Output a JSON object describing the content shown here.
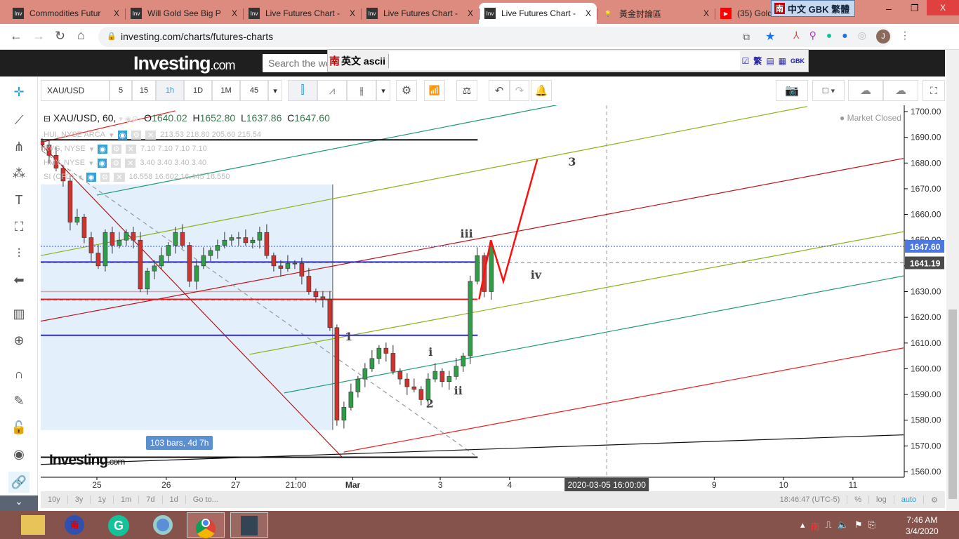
{
  "browser": {
    "tabs": [
      {
        "label": "Commodities Futur",
        "icon": "investing-favicon"
      },
      {
        "label": "Will Gold See Big P",
        "icon": "investing-favicon"
      },
      {
        "label": "Live Futures Chart -",
        "icon": "investing-favicon"
      },
      {
        "label": "Live Futures Chart -",
        "icon": "investing-favicon"
      },
      {
        "label": "Live Futures Chart -",
        "icon": "investing-favicon",
        "active": true
      },
      {
        "label": "黃金討論區",
        "icon": "bulb-favicon"
      },
      {
        "label": "(35) Gold",
        "icon": "youtube-favicon"
      }
    ],
    "tab_close": "X",
    "ime_badge": "中文 GBK 繁體",
    "url": "investing.com/charts/futures-charts",
    "profile_initial": "J"
  },
  "site": {
    "logo": "Investing",
    "logo_suffix": ".com",
    "search_placeholder": "Search the we"
  },
  "ime_bar": {
    "mode": "英文 ascii",
    "icon": "南",
    "buttons": [
      "繁",
      "GBK"
    ]
  },
  "toolbar": {
    "symbol": "XAU/USD",
    "intervals": [
      "5",
      "15",
      "1h",
      "1D",
      "1M",
      "45"
    ],
    "active_interval": "1h"
  },
  "legend": {
    "main": {
      "title": "XAU/USD, 60,",
      "o": "O",
      "o_val": "1640.02",
      "h": "H",
      "h_val": "1652.80",
      "l": "L",
      "l_val": "1637.86",
      "c": "C",
      "c_val": "1647.60"
    },
    "studies": [
      {
        "name": "HUI, NYSE ARCA",
        "vals": "213.53   218.80   205.60   215.54"
      },
      {
        "name": "RVG, NYSE",
        "vals": "7.10   7.10   7.10   7.10"
      },
      {
        "name": "HMY, NYSE",
        "vals": "3.40   3.40   3.40   3.40"
      },
      {
        "name": "SI (CFD)",
        "vals": "16.558   16.602   16.445   16.550"
      }
    ]
  },
  "status": "Market Closed",
  "range_label": "103 bars, 4d 7h",
  "watermark": "Investing.com",
  "wave_labels": [
    {
      "text": "3",
      "t": 6.85,
      "p": 1679
    },
    {
      "text": "iii",
      "t": 5.33,
      "p": 1651
    },
    {
      "text": "iv",
      "t": 6.33,
      "p": 1635
    },
    {
      "text": "1",
      "t": 3.63,
      "p": 1611
    },
    {
      "text": "i",
      "t": 4.81,
      "p": 1605
    },
    {
      "text": "ii",
      "t": 5.21,
      "p": 1590
    },
    {
      "text": "2",
      "t": 4.8,
      "p": 1585
    }
  ],
  "chart_data": {
    "type": "candlestick",
    "symbol": "XAU/USD",
    "interval": "60",
    "ylim": [
      1560,
      1700
    ],
    "yticks": [
      1700,
      1690,
      1680,
      1670,
      1660,
      1650,
      1640,
      1630,
      1620,
      1610,
      1600,
      1590,
      1580,
      1570,
      1560
    ],
    "xticks": [
      {
        "label": "25",
        "t": 0
      },
      {
        "label": "26",
        "t": 1
      },
      {
        "label": "27",
        "t": 2
      },
      {
        "label": "21:00",
        "t": 2.87
      },
      {
        "label": "Mar",
        "t": 3.69,
        "bold": true
      },
      {
        "label": "3",
        "t": 4.95
      },
      {
        "label": "4",
        "t": 5.95
      },
      {
        "label": "5",
        "t": 6.95
      },
      {
        "label": "9",
        "t": 8.9
      },
      {
        "label": "10",
        "t": 9.9
      },
      {
        "label": "11",
        "t": 10.9
      }
    ],
    "crosshair_time": "2020-03-05 16:00:00",
    "crosshair_t": 7.35,
    "last_price": "1647.60",
    "last_price_value": 1647.6,
    "crosshair_price": "1641.19",
    "crosshair_price_value": 1641.19,
    "closes": [
      1687,
      1683,
      1678,
      1673,
      1657,
      1659,
      1651,
      1645,
      1640,
      1653,
      1648,
      1650,
      1653,
      1650,
      1631,
      1638,
      1640,
      1644,
      1648,
      1653,
      1648,
      1634,
      1640,
      1644,
      1646,
      1648,
      1650,
      1651,
      1651,
      1649,
      1650,
      1653,
      1644,
      1640,
      1639,
      1641,
      1641,
      1636,
      1630,
      1628,
      1627,
      1616,
      1580,
      1585,
      1591,
      1596,
      1600,
      1604,
      1608,
      1606,
      1599,
      1596,
      1593,
      1592,
      1588,
      1596,
      1599,
      1595,
      1597,
      1601,
      1605,
      1634,
      1644,
      1630,
      1647.6
    ],
    "first_bar_t": -0.79,
    "bar_step_t": 0.1012,
    "hlines": [
      {
        "p": 1689,
        "color": "#111",
        "t0": -0.81,
        "t1": 5.49
      },
      {
        "p": 1641.5,
        "color": "#2a2ae6",
        "t0": -0.81,
        "t1": 5.49
      },
      {
        "p": 1627,
        "color": "#e02020",
        "t0": -0.81,
        "t1": 5.49
      },
      {
        "p": 1613,
        "color": "#2a2ae6",
        "t0": -0.81,
        "t1": 5.49
      },
      {
        "p": 1565.6,
        "color": "#111",
        "t0": -0.81,
        "t1": 5.49
      }
    ],
    "trendlines": [
      {
        "color": "#1a9a7a",
        "p0": [
          0,
          1667.5
        ],
        "p1": [
          6.98,
          1704.4
        ]
      },
      {
        "color": "#8ab31a",
        "p0": [
          -0.81,
          1644
        ],
        "p1": [
          10.24,
          1702
        ]
      },
      {
        "color": "#c0141c",
        "p0": [
          -0.81,
          1618.5
        ],
        "p1": [
          11.63,
          1681.8
        ]
      },
      {
        "color": "#8ab31a",
        "p0": [
          2.2,
          1605.6
        ],
        "p1": [
          11.63,
          1653.3
        ]
      },
      {
        "color": "#1a9a7a",
        "p0": [
          2.7,
          1590.6
        ],
        "p1": [
          11.63,
          1636.1
        ]
      },
      {
        "color": "#e82020",
        "p0": [
          3.56,
          1567.6
        ],
        "p1": [
          11.63,
          1608.1
        ]
      },
      {
        "color": "#e82020",
        "p0": [
          -0.81,
          1688
        ],
        "p1": [
          1.13,
          1700.3
        ]
      },
      {
        "color": "#b01818",
        "p0": [
          -0.81,
          1687.5
        ],
        "p1": [
          3.54,
          1565.5
        ]
      },
      {
        "color": "#999",
        "dash": true,
        "p0": [
          -0.79,
          1684.7
        ],
        "p1": [
          5.49,
          1565.6
        ]
      },
      {
        "color": "#111",
        "p0": [
          -0.81,
          1562.8
        ],
        "p1": [
          11.63,
          1574.3
        ]
      }
    ],
    "projection": {
      "color": "#ff1010",
      "points": [
        [
          5.51,
          1627
        ],
        [
          5.68,
          1650
        ],
        [
          5.86,
          1634
        ],
        [
          6.35,
          1681.5
        ]
      ]
    },
    "shaded_range": {
      "t0": -0.81,
      "t1": 3.4,
      "p0": 1671.7,
      "p1": 1576.2
    }
  },
  "bottom": {
    "ranges": [
      "10y",
      "3y",
      "1y",
      "1m",
      "7d",
      "1d",
      "Go to..."
    ],
    "clock": "18:46:47 (UTC-5)",
    "pct": "%",
    "log": "log",
    "auto": "auto"
  },
  "taskbar": {
    "time": "7:46 AM",
    "date": "3/4/2020"
  }
}
